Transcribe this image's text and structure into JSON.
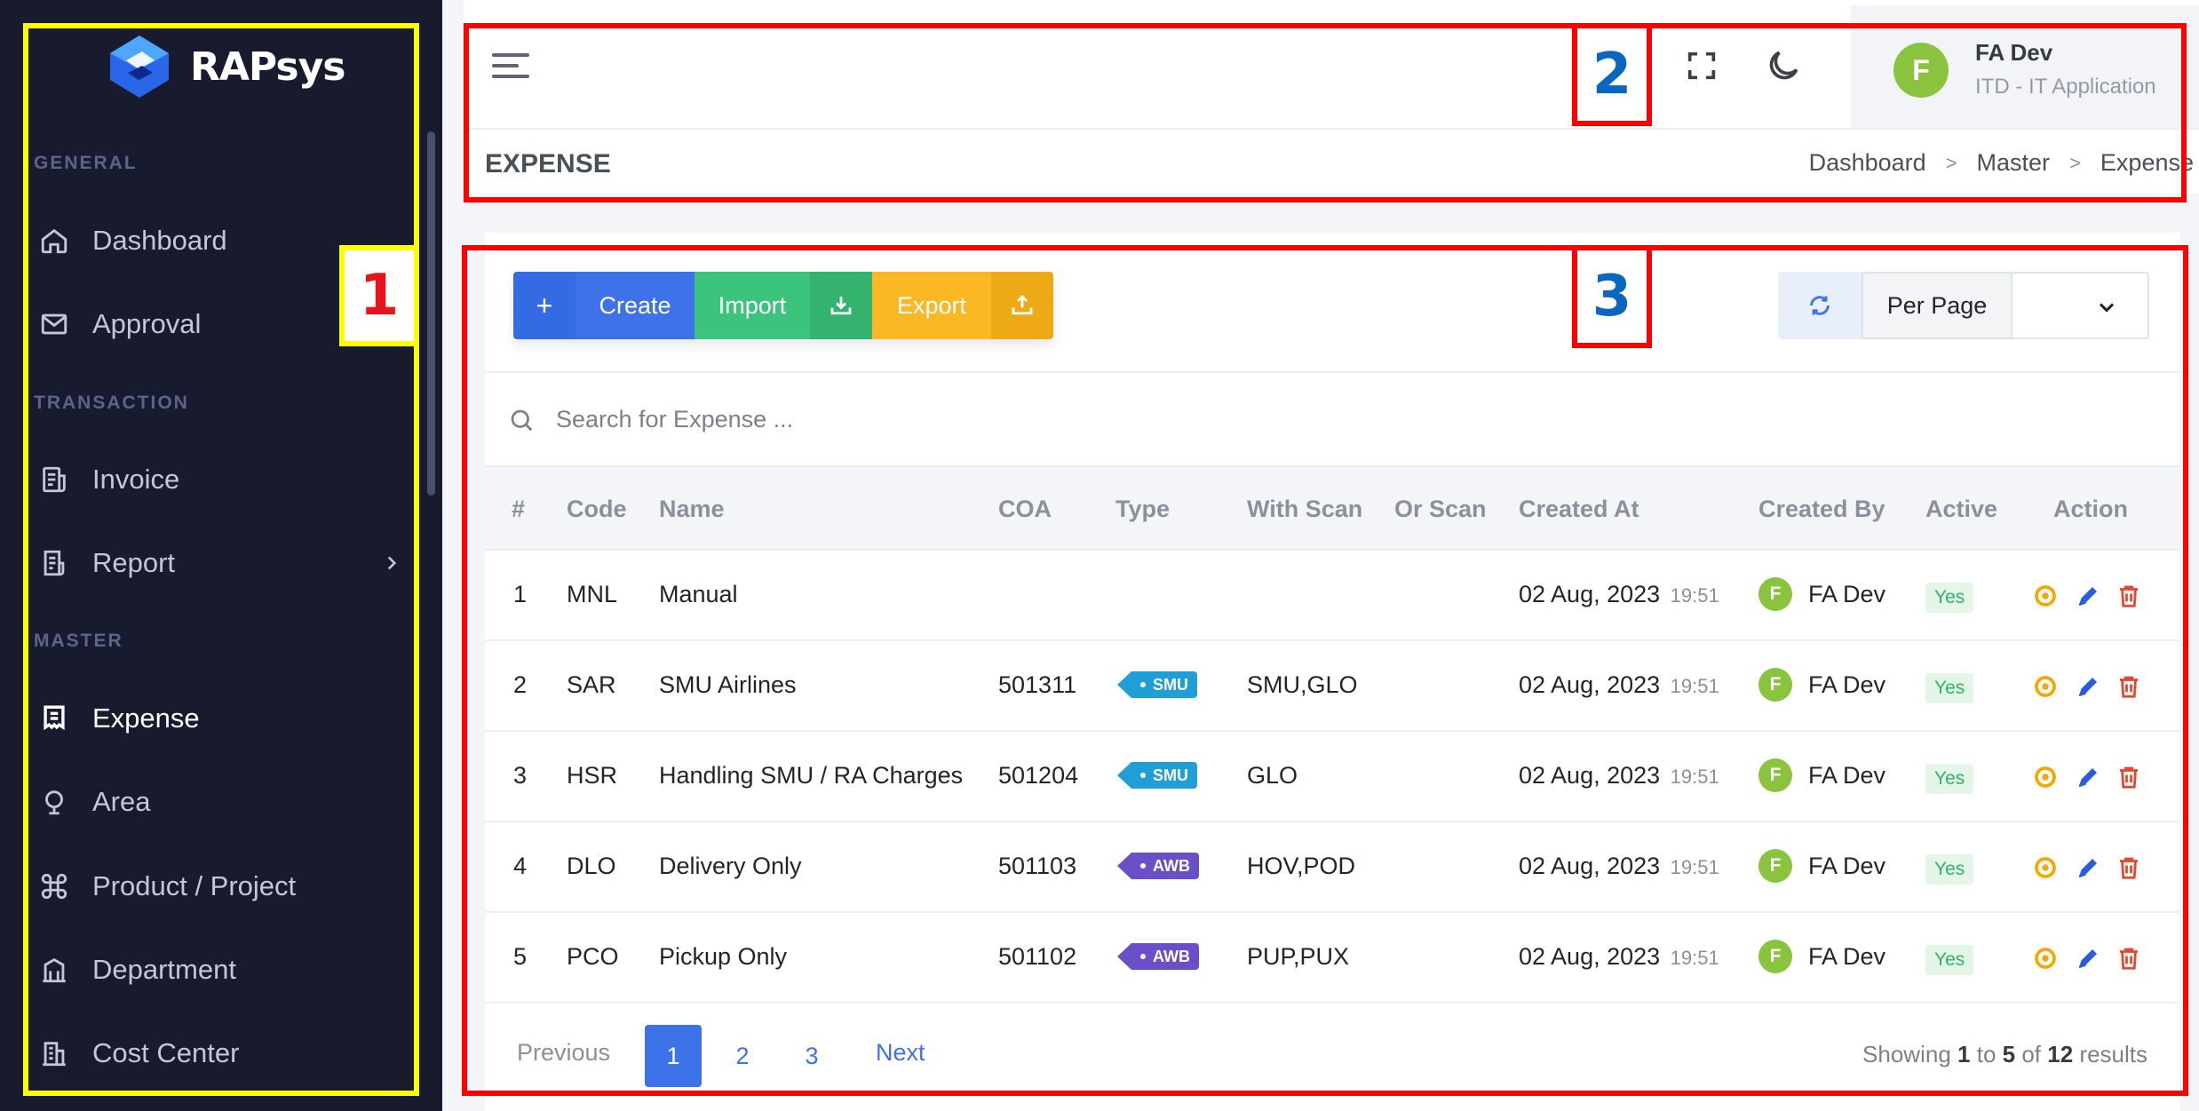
{
  "sidebar": {
    "brand": "RAPsys",
    "sections": {
      "general": "GENERAL",
      "transaction": "TRANSACTION",
      "master": "MASTER"
    },
    "items": [
      {
        "label": "Dashboard",
        "icon": "home-icon"
      },
      {
        "label": "Approval",
        "icon": "mail-icon"
      },
      {
        "label": "Invoice",
        "icon": "invoice-icon"
      },
      {
        "label": "Report",
        "icon": "report-icon"
      },
      {
        "label": "Expense",
        "icon": "expense-icon",
        "active": true
      },
      {
        "label": "Area",
        "icon": "map-pin-icon"
      },
      {
        "label": "Product / Project",
        "icon": "command-icon"
      },
      {
        "label": "Department",
        "icon": "building-icon"
      },
      {
        "label": "Cost Center",
        "icon": "office-icon"
      }
    ]
  },
  "header": {
    "user_initial": "F",
    "user_name": "FA Dev",
    "user_dept": "ITD - IT Application",
    "page_title": "EXPENSE",
    "breadcrumb": [
      "Dashboard",
      "Master",
      "Expense"
    ]
  },
  "toolbar": {
    "create_icon": "+",
    "create_label": "Create",
    "import_label": "Import",
    "export_label": "Export",
    "per_page_label": "Per Page",
    "search_placeholder": "Search for Expense ..."
  },
  "table": {
    "columns": [
      "#",
      "Code",
      "Name",
      "COA",
      "Type",
      "With Scan",
      "Or Scan",
      "Created At",
      "Created By",
      "Active",
      "Action"
    ],
    "rows": [
      {
        "no": "1",
        "code": "MNL",
        "name": "Manual",
        "coa": "",
        "type": "",
        "with_scan": "",
        "or_scan": "",
        "date": "02 Aug, 2023",
        "time": "19:51",
        "initial": "F",
        "by": "FA Dev",
        "active": "Yes"
      },
      {
        "no": "2",
        "code": "SAR",
        "name": "SMU Airlines",
        "coa": "501311",
        "type": "SMU",
        "with_scan": "SMU,GLO",
        "or_scan": "",
        "date": "02 Aug, 2023",
        "time": "19:51",
        "initial": "F",
        "by": "FA Dev",
        "active": "Yes"
      },
      {
        "no": "3",
        "code": "HSR",
        "name": "Handling SMU / RA Charges",
        "coa": "501204",
        "type": "SMU",
        "with_scan": "GLO",
        "or_scan": "",
        "date": "02 Aug, 2023",
        "time": "19:51",
        "initial": "F",
        "by": "FA Dev",
        "active": "Yes"
      },
      {
        "no": "4",
        "code": "DLO",
        "name": "Delivery Only",
        "coa": "501103",
        "type": "AWB",
        "with_scan": "HOV,POD",
        "or_scan": "",
        "date": "02 Aug, 2023",
        "time": "19:51",
        "initial": "F",
        "by": "FA Dev",
        "active": "Yes"
      },
      {
        "no": "5",
        "code": "PCO",
        "name": "Pickup Only",
        "coa": "501102",
        "type": "AWB",
        "with_scan": "PUP,PUX",
        "or_scan": "",
        "date": "02 Aug, 2023",
        "time": "19:51",
        "initial": "F",
        "by": "FA Dev",
        "active": "Yes"
      }
    ]
  },
  "pagination": {
    "previous": "Previous",
    "pages": [
      "1",
      "2",
      "3"
    ],
    "current": "1",
    "next": "Next",
    "showing_prefix": "Showing",
    "from": "1",
    "to_word": "to",
    "to": "5",
    "of_word": "of",
    "total": "12",
    "results_word": "results"
  },
  "annotations": [
    "1",
    "2",
    "3"
  ],
  "colors": {
    "sidebar_bg": "#181b2e",
    "create": "#3d72e8",
    "import": "#3cc47c",
    "export": "#f9b824",
    "badge_smu": "#1f9fd6",
    "badge_awb": "#6a4fc9",
    "avatar": "#8ac43f",
    "annotation_yellow": "#ffff00",
    "annotation_red": "#ff0000",
    "annotation_label_red": "#e8141c",
    "annotation_label_blue": "#0a67c1"
  }
}
